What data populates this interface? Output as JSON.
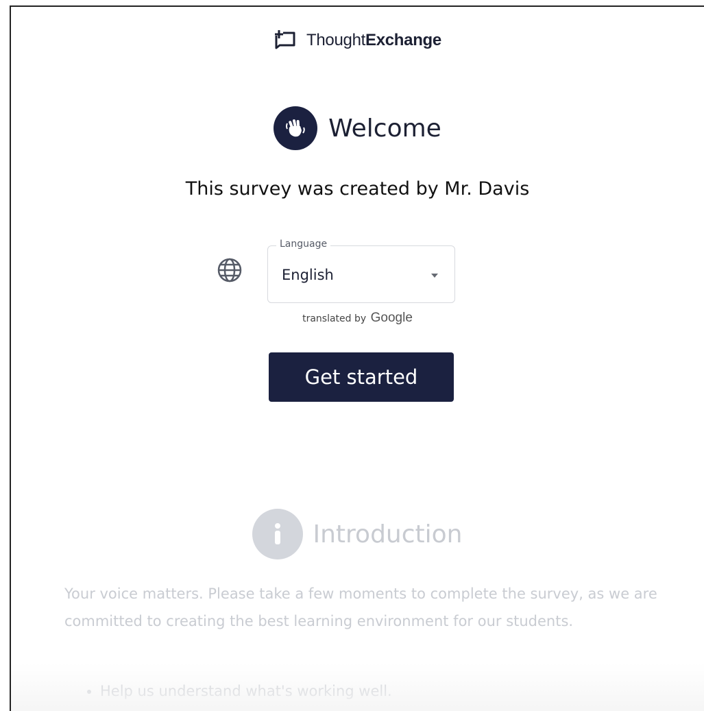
{
  "header": {
    "brand_light": "Thought",
    "brand_bold": "Exchange",
    "logo_icon": "chat-bubble-plus-icon"
  },
  "welcome": {
    "title": "Welcome",
    "icon": "waving-hands-icon",
    "creator_text": "This survey was created by Mr. Davis"
  },
  "language": {
    "label": "Language",
    "selected": "English",
    "icon": "globe-icon",
    "translated_by": "translated by",
    "translator": "Google"
  },
  "cta": {
    "label": "Get started"
  },
  "introduction": {
    "title": "Introduction",
    "icon": "info-icon",
    "paragraph": "Your voice matters. Please take a few moments to complete the survey, as we are committed to creating the best learning environment for our students.",
    "bullets": [
      "Help us understand what's working well."
    ]
  },
  "colors": {
    "primary": "#1b2140",
    "muted_text": "#c9ccd2"
  }
}
